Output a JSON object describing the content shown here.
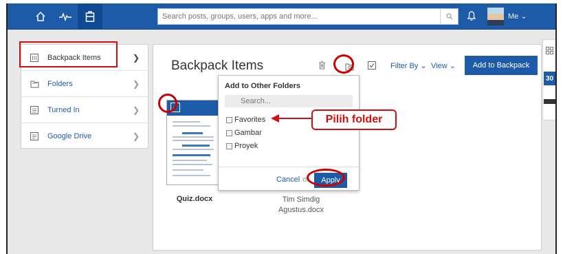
{
  "topbar": {
    "search_placeholder": "Search posts, groups, users, apps and more...",
    "user_label": "Me",
    "icons": [
      "home-icon",
      "activity-icon",
      "backpack-icon",
      "search-icon",
      "bell-icon",
      "chevron-down-icon"
    ]
  },
  "sidebar": {
    "items": [
      {
        "label": "Backpack Items",
        "icon": "grid-icon"
      },
      {
        "label": "Folders",
        "icon": "folder-icon"
      },
      {
        "label": "Turned In",
        "icon": "inbox-icon"
      },
      {
        "label": "Google Drive",
        "icon": "drive-icon"
      }
    ]
  },
  "main": {
    "title": "Backpack Items",
    "filter_label": "Filter By",
    "view_label": "View",
    "add_button": "Add to Backpack",
    "items": [
      {
        "name": "Quiz.docx"
      },
      {
        "name_line1": "Tim Simdig",
        "name_line2": "Agustus.docx"
      }
    ]
  },
  "dropdown": {
    "title": "Add to Other Folders",
    "search_placeholder": "Search...",
    "options": [
      "Favorites",
      "Gambar",
      "Proyek"
    ],
    "cancel": "Cancel",
    "or": "or",
    "apply": "Apply"
  },
  "rightbar": {
    "calendar_day": "30"
  },
  "annotation": {
    "callout": "Pilih folder",
    "color": "#d01010"
  }
}
